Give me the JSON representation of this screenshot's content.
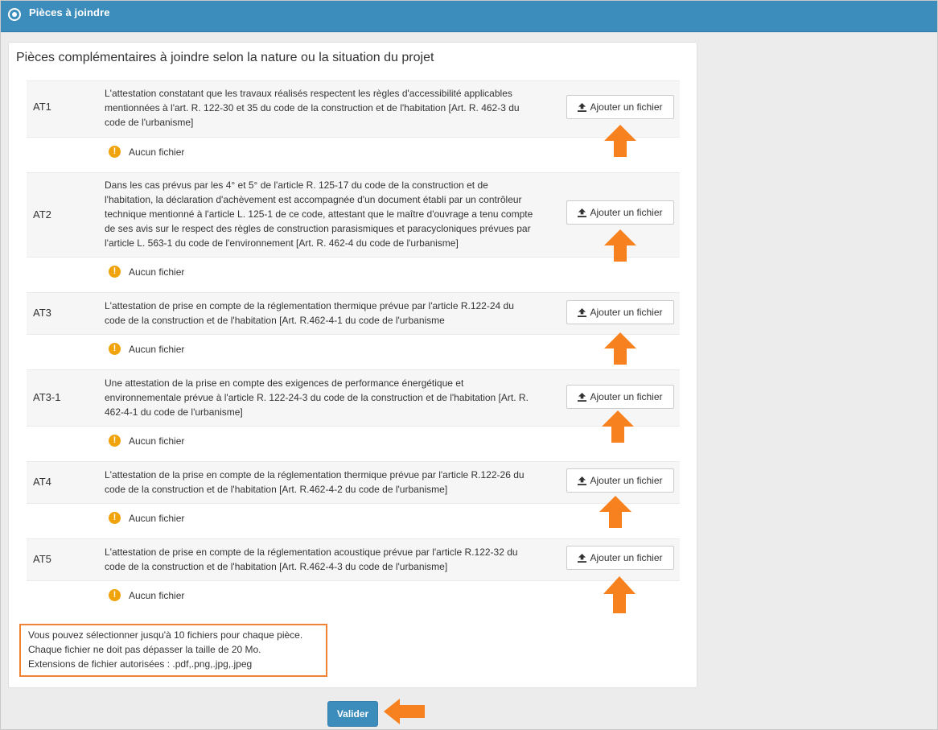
{
  "header": {
    "title": "Pièces à joindre",
    "icon": "radio-circle-icon"
  },
  "panel": {
    "title": "Pièces complémentaires à joindre selon la nature ou la situation du projet"
  },
  "items": [
    {
      "code": "AT1",
      "lines": [
        "L'attestation constatant que les travaux réalisés respectent les règles d'accessibilité applicables",
        "mentionnées à l'art. R. 122-30 et 35 du code de la construction et de l'habitation [Art. R. 462-3 du",
        "code de l'urbanisme]"
      ],
      "button_label": "Ajouter un fichier",
      "status": "Aucun fichier"
    },
    {
      "code": "AT2",
      "lines": [
        "Dans les cas prévus par les 4° et 5° de l'article R. 125-17 du code de la construction et de",
        "l'habitation, la déclaration d'achèvement est accompagnée d'un document établi par un contrôleur",
        "technique mentionné à l'article L. 125-1 de ce code, attestant que le maître d'ouvrage a tenu compte",
        "de ses avis sur le respect des règles de construction parasismiques et paracycloniques prévues par",
        "l'article L. 563-1 du code de l'environnement [Art. R. 462-4 du code de l'urbanisme]"
      ],
      "button_label": "Ajouter un fichier",
      "status": "Aucun fichier"
    },
    {
      "code": "AT3",
      "lines": [
        "L'attestation de prise en compte de la réglementation thermique prévue par l'article R.122-24 du",
        "code de la construction et de l'habitation [Art. R.462-4-1 du code de l'urbanisme"
      ],
      "button_label": "Ajouter un fichier",
      "status": "Aucun fichier"
    },
    {
      "code": "AT3-1",
      "lines": [
        "Une attestation de la prise en compte des exigences de performance énergétique et",
        "environnementale prévue à l'article R. 122-24-3 du code de la construction et de l'habitation [Art. R.",
        "462-4-1 du code de l'urbanisme]"
      ],
      "button_label": "Ajouter un fichier",
      "status": "Aucun fichier"
    },
    {
      "code": "AT4",
      "lines": [
        "L'attestation de la prise en compte de la réglementation thermique prévue par l'article R.122-26 du",
        "code de la construction et de l'habitation [Art. R.462-4-2 du code de l'urbanisme]"
      ],
      "button_label": "Ajouter un fichier",
      "status": "Aucun fichier"
    },
    {
      "code": "AT5",
      "lines": [
        "L'attestation de prise en compte de la réglementation acoustique prévue par l'article R.122-32 du",
        "code de la construction et de l'habitation [Art. R.462-4-3 du code de l'urbanisme]"
      ],
      "button_label": "Ajouter un fichier",
      "status": "Aucun fichier"
    }
  ],
  "info": {
    "lines": [
      "Vous pouvez sélectionner jusqu'à 10 fichiers pour chaque pièce.",
      "Chaque fichier ne doit pas dépasser la taille de 20 Mo.",
      "Extensions de fichier autorisées : .pdf,.png,.jpg,.jpeg"
    ]
  },
  "submit": {
    "label": "Valider"
  },
  "colors": {
    "header_bg": "#3c8dbc",
    "accent_orange": "#f7811e",
    "warning": "#f0a30a",
    "row_bg": "#f6f6f6"
  },
  "icons": {
    "upload": "upload-icon",
    "warning": "warning-circle-icon",
    "annotation_up": "arrow-up-annotation",
    "annotation_left": "arrow-left-annotation"
  }
}
